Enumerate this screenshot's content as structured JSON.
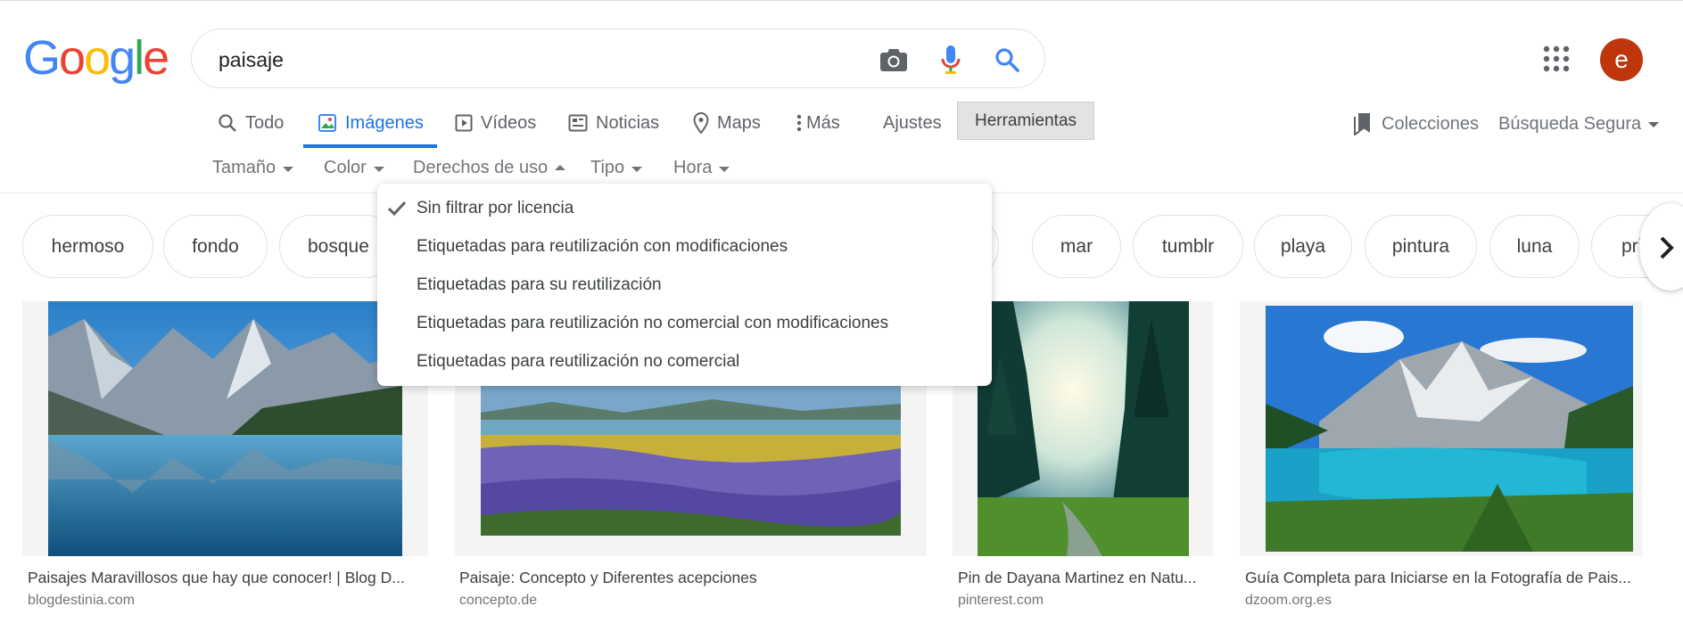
{
  "logo": {
    "text": "Google"
  },
  "search": {
    "query": "paisaje"
  },
  "user": {
    "avatar_letter": "e"
  },
  "colors": {
    "accent": "#1a73e8",
    "avatar": "#bf360c",
    "tools_bg": "#e3e3e3"
  },
  "icons": {
    "camera": "camera-icon",
    "mic": "mic-icon",
    "search": "search-icon",
    "apps": "apps-grid-icon",
    "check": "check-icon",
    "chevron": "chevron-right-icon"
  },
  "nav": {
    "tabs": [
      {
        "label": "Todo",
        "icon": "search-icon",
        "active": false
      },
      {
        "label": "Imágenes",
        "icon": "image-icon",
        "active": true
      },
      {
        "label": "Vídeos",
        "icon": "play-icon",
        "active": false
      },
      {
        "label": "Noticias",
        "icon": "news-icon",
        "active": false
      },
      {
        "label": "Maps",
        "icon": "map-pin-icon",
        "active": false
      },
      {
        "label": "Más",
        "icon": "more-vert-icon",
        "active": false
      }
    ],
    "settings": "Ajustes",
    "tools": "Herramientas",
    "collections": "Colecciones",
    "safe_search": "Búsqueda Segura"
  },
  "filters": {
    "size": "Tamaño",
    "color": "Color",
    "rights": "Derechos de uso",
    "type": "Tipo",
    "time": "Hora"
  },
  "chips": [
    "hermoso",
    "fondo",
    "bosque",
    "mar",
    "tumblr",
    "playa",
    "pintura",
    "luna",
    "pri"
  ],
  "rights_menu": {
    "selected_index": 0,
    "options": [
      "Sin filtrar por licencia",
      "Etiquetadas para reutilización con modificaciones",
      "Etiquetadas para su reutilización",
      "Etiquetadas para reutilización no comercial con modificaciones",
      "Etiquetadas para reutilización no comercial"
    ]
  },
  "results": [
    {
      "title": "Paisajes Maravillosos que hay que conocer! | Blog D...",
      "site": "blogdestinia.com"
    },
    {
      "title": "Paisaje: Concepto y Diferentes acepciones",
      "site": "concepto.de"
    },
    {
      "title": "Pin de Dayana Martinez en Natu...",
      "site": "pinterest.com"
    },
    {
      "title": "Guía Completa para Iniciarse en la Fotografía de Pais...",
      "site": "dzoom.org.es"
    }
  ]
}
